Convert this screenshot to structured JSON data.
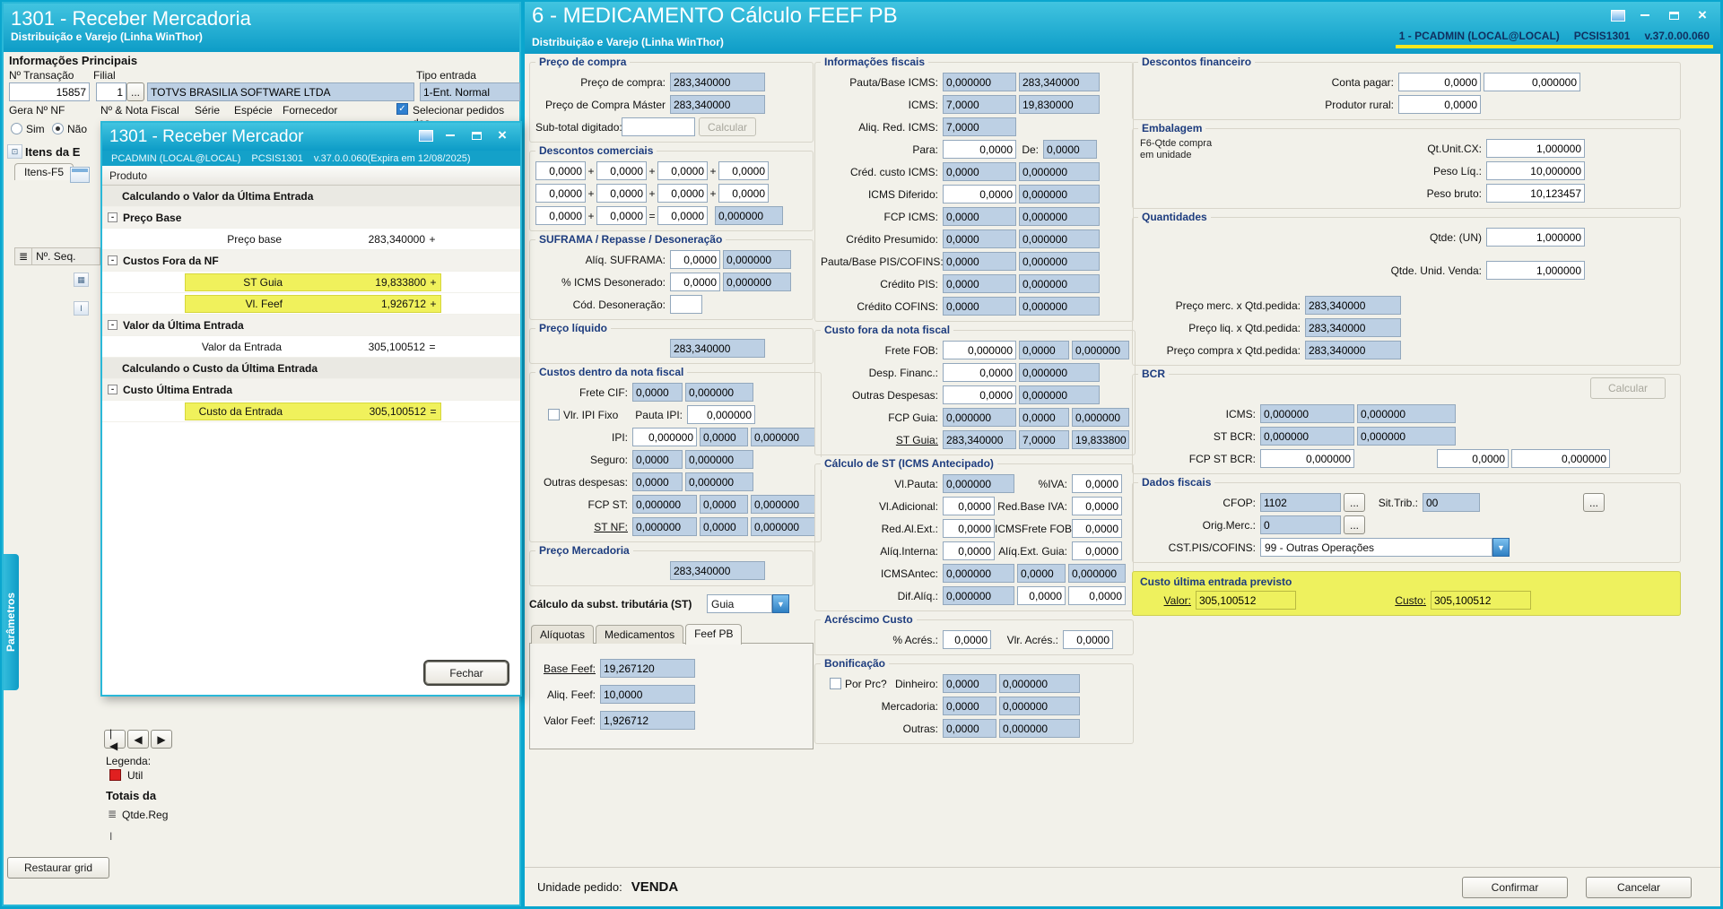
{
  "icons": {
    "check": "✓",
    "dropdown": "▼",
    "dots": "...",
    "close": "×",
    "minus": "-",
    "nav_first": "|◀",
    "nav_prev": "◀",
    "nav_next": "▶",
    "grid": "▦",
    "ibeam": "I",
    "rows": "≣",
    "panel": "⊡"
  },
  "z": {
    "v4": "0,0000",
    "v6": "0,000000",
    "plus": "+",
    "eq": "="
  },
  "left": {
    "title": "1301 - Receber Mercadoria",
    "subtitle": "Distribuição e Varejo (Linha WinThor)",
    "secao": "Informações Principais",
    "ntrans_l": "Nº Transação",
    "ntrans_v": "15857",
    "filial_l": "Filial",
    "filial_n": "1",
    "filial_nome": "TOTVS BRASILIA SOFTWARE LTDA",
    "tipo_l": "Tipo entrada",
    "tipo_v": "1-Ent. Normal",
    "gera_l": "Gera Nº NF",
    "sim": "Sim",
    "nao": "Não",
    "nf_l": "Nº & Nota Fiscal",
    "serie_l": "Série",
    "especie_l": "Espécie",
    "fornecedor_l": "Fornecedor",
    "selecionar": "Selecionar pedidos dos",
    "itens_h": "Itens da E",
    "tab_itens": "Itens-F5",
    "col_seq": "Nº. Seq.",
    "legenda": "Legenda:",
    "util": "Util",
    "totais": "Totais da",
    "qtdereg": "Qtde.Reg",
    "restaurar": "Restaurar grid",
    "parametros": "Parâmetros"
  },
  "dlg": {
    "title": "1301 - Receber Mercador",
    "sub1": "PCADMIN (LOCAL@LOCAL)",
    "sub2": "PCSIS1301",
    "sub3": "v.37.0.0.060(Expira em 12/08/2025)",
    "produto": "Produto",
    "rows": [
      {
        "t": "band",
        "label": "Calculando o Valor da Última Entrada"
      },
      {
        "t": "group",
        "label": "Preço Base"
      },
      {
        "t": "item",
        "label": "Preço base",
        "value": "283,340000",
        "sign": "+"
      },
      {
        "t": "group",
        "label": "Custos Fora da NF"
      },
      {
        "t": "item",
        "label": "ST Guia",
        "value": "19,833800",
        "sign": "+",
        "hl": true
      },
      {
        "t": "item",
        "label": "Vl. Feef",
        "value": "1,926712",
        "sign": "+",
        "hl": true
      },
      {
        "t": "group",
        "label": "Valor da Última Entrada"
      },
      {
        "t": "item",
        "label": "Valor da Entrada",
        "value": "305,100512",
        "sign": "="
      },
      {
        "t": "band",
        "label": "Calculando o Custo da Última Entrada"
      },
      {
        "t": "group",
        "label": "Custo Última Entrada"
      },
      {
        "t": "item",
        "label": "Custo da Entrada",
        "value": "305,100512",
        "sign": "=",
        "hl": true
      }
    ],
    "fechar": "Fechar"
  },
  "right": {
    "title": "6 - MEDICAMENTO Cálculo FEEF PB",
    "subtitle": "Distribuição e Varejo (Linha WinThor)",
    "st1": "1 - PCADMIN (LOCAL@LOCAL)",
    "st2": "PCSIS1301",
    "st3": "v.37.0.00.060",
    "pc": {
      "lg": "Preço de compra",
      "l1": "Preço de compra:",
      "v1": "283,340000",
      "l2": "Preço de Compra Máster",
      "v2": "283,340000",
      "l3": "Sub-total digitado:",
      "calc": "Calcular"
    },
    "dc": {
      "lg": "Descontos comerciais"
    },
    "suf": {
      "lg": "SUFRAMA / Repasse / Desoneração",
      "l1": "Alíq. SUFRAMA:",
      "l2": "% ICMS Desonerado:",
      "l3": "Cód. Desoneração:"
    },
    "pliq": {
      "lg": "Preço líquido",
      "v": "283,340000"
    },
    "cd": {
      "lg": "Custos dentro da nota fiscal",
      "l1": "Frete CIF:",
      "cb": "Vlr. IPI Fixo",
      "l2": "Pauta IPI:",
      "l3": "IPI:",
      "l4": "Seguro:",
      "l5": "Outras despesas:",
      "l6": "FCP ST:",
      "l7": "ST NF:"
    },
    "pmerc": {
      "lg": "Preço Mercadoria",
      "v": "283,340000"
    },
    "stc": {
      "l": "Cálculo da subst. tributária (ST)",
      "v": "Guia"
    },
    "tabs": [
      "Alíquotas",
      "Medicamentos",
      "Feef PB"
    ],
    "feef": {
      "l1": "Base Feef:",
      "v1": "19,267120",
      "l2": "Aliq. Feef:",
      "v2": "10,0000",
      "l3": "Valor Feef:",
      "v3": "1,926712"
    },
    "fis": {
      "lg": "Informações fiscais",
      "l1": "Pauta/Base ICMS:",
      "v1b": "283,340000",
      "l2": "ICMS:",
      "v2a": "7,0000",
      "v2b": "19,830000",
      "l3": "Aliq. Red. ICMS:",
      "v3": "7,0000",
      "l4": "Para:",
      "l4b": "De:",
      "l5": "Créd. custo ICMS:",
      "l6": "ICMS Diferido:",
      "l7": "FCP ICMS:",
      "l8": "Crédito Presumido:",
      "l9": "Pauta/Base PIS/COFINS:",
      "l10": "Crédito PIS:",
      "l11": "Crédito COFINS:"
    },
    "cf": {
      "lg": "Custo fora da nota fiscal",
      "l1": "Frete FOB:",
      "l2": "Desp. Financ.:",
      "l3": "Outras Despesas:",
      "l4": "FCP Guia:",
      "l5": "ST Guia:",
      "v5a": "283,340000",
      "v5b": "7,0000",
      "v5c": "19,833800"
    },
    "cst": {
      "lg": "Cálculo de ST (ICMS Antecipado)",
      "l1": "Vl.Pauta:",
      "l1b": "%IVA:",
      "l2": "Vl.Adicional:",
      "l2b": "Red.Base IVA:",
      "l3": "Red.Al.Ext.:",
      "l3b": "ICMSFrete FOB:",
      "l4": "Alíq.Interna:",
      "l4b": "Alíq.Ext. Guia:",
      "l5": "ICMSAntec:",
      "l6": "Dif.Alíq.:"
    },
    "ac": {
      "lg": "Acréscimo Custo",
      "l1": "% Acrés.:",
      "l2": "Vlr. Acrés.:"
    },
    "bon": {
      "lg": "Bonificação",
      "cb": "Por Prc?",
      "l1": "Dinheiro:",
      "l2": "Mercadoria:",
      "l3": "Outras:"
    },
    "df": {
      "lg": "Descontos financeiro",
      "l1": "Conta pagar:",
      "l2": "Produtor rural:"
    },
    "emb": {
      "lg": "Embalagem",
      "n1": "F6-Qtde compra",
      "n2": "em unidade",
      "l1": "Qt.Unit.CX:",
      "v1": "1,000000",
      "l2": "Peso Líq.:",
      "v2": "10,000000",
      "l3": "Peso bruto:",
      "v3": "10,123457"
    },
    "qt": {
      "lg": "Quantidades",
      "l1": "Qtde: (UN)",
      "v1": "1,000000",
      "l2": "Qtde. Unid. Venda:",
      "v2": "1,000000",
      "l3": "Preço merc. x Qtd.pedida:",
      "v3": "283,340000",
      "l4": "Preço liq. x Qtd.pedida:",
      "v4": "283,340000",
      "l5": "Preço compra x Qtd.pedida:",
      "v5": "283,340000"
    },
    "bcr": {
      "lg": "BCR",
      "calc": "Calcular",
      "l1": "ICMS:",
      "l2": "ST BCR:",
      "l3": "FCP ST BCR:"
    },
    "dad": {
      "lg": "Dados fiscais",
      "l1": "CFOP:",
      "v1": "1102",
      "l2": "Sit.Trib.:",
      "v2": "00",
      "l3": "Orig.Merc.:",
      "v3": "0",
      "l4": "CST.PIS/COFINS:",
      "v4": "99 - Outras Operações"
    },
    "cue": {
      "lg": "Custo última entrada previsto",
      "l1": "Valor:",
      "v1": "305,100512",
      "l2": "Custo:",
      "v2": "305,100512"
    },
    "foot": {
      "l": "Unidade pedido:",
      "v": "VENDA",
      "ok": "Confirmar",
      "cancel": "Cancelar"
    }
  }
}
